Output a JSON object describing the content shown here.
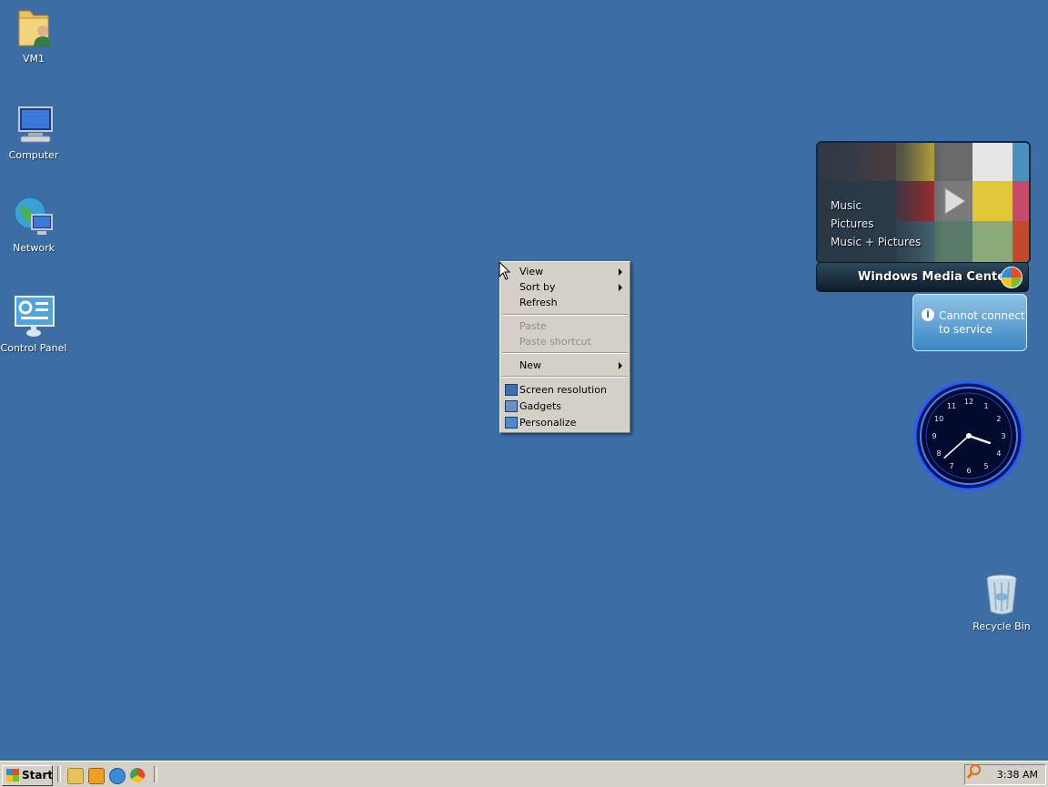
{
  "desktop": {
    "icons": [
      {
        "label": "VM1",
        "icon": "user-folder-icon"
      },
      {
        "label": "Computer",
        "icon": "computer-icon"
      },
      {
        "label": "Network",
        "icon": "network-icon"
      },
      {
        "label": "Control Panel",
        "icon": "control-panel-icon"
      },
      {
        "label": "Recycle Bin",
        "icon": "recycle-bin-icon"
      }
    ]
  },
  "context_menu": {
    "view": "View",
    "sort_by": "Sort by",
    "refresh": "Refresh",
    "paste": "Paste",
    "paste_shortcut": "Paste shortcut",
    "new": "New",
    "screen_resolution": "Screen resolution",
    "gadgets": "Gadgets",
    "personalize": "Personalize"
  },
  "media_center": {
    "items": [
      "Music",
      "Pictures",
      "Music + Pictures"
    ],
    "title": "Windows Media Center"
  },
  "info_gadget": {
    "line1": "Cannot connect",
    "line2": "to service"
  },
  "clock": {
    "numbers": [
      "12",
      "1",
      "2",
      "3",
      "4",
      "5",
      "6",
      "7",
      "8",
      "9",
      "10",
      "11"
    ],
    "hour": 3,
    "minute": 38
  },
  "taskbar": {
    "start_label": "Start",
    "time": "3:38 AM",
    "quick_launch": [
      "explorer-icon",
      "media-player-icon",
      "internet-explorer-icon",
      "chrome-icon"
    ]
  },
  "colors": {
    "desktop": "#3c6ea5",
    "taskbar": "#d4d0c8"
  }
}
